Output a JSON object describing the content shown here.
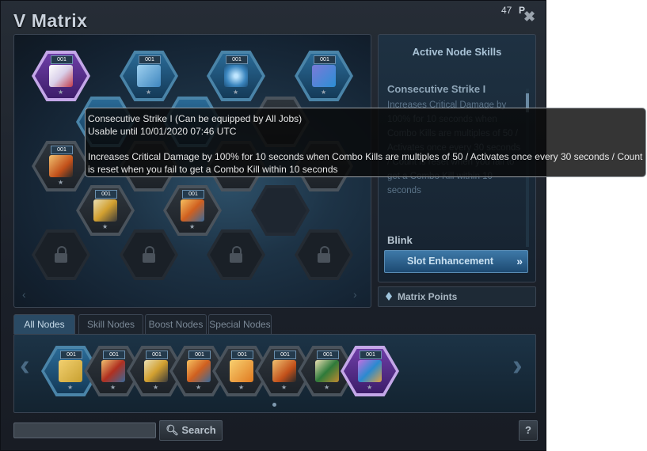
{
  "window": {
    "title": "V Matrix",
    "close_glyph": "✖"
  },
  "matrix": {
    "node_level": "001",
    "star": "★",
    "nav_left": "‹",
    "nav_right": "›",
    "nodes": [
      {
        "icon": "consecutive-strike-icon",
        "style": "purple"
      },
      {
        "icon": "skill-node-icon-2",
        "style": "blue"
      },
      {
        "icon": "skill-node-icon-3",
        "style": "blue"
      },
      {
        "icon": "skill-node-icon-4",
        "style": "blue"
      },
      {
        "icon": "boost-node-icon-1",
        "style": "boost"
      },
      {
        "icon": "boost-node-icon-2",
        "style": "boost"
      },
      {
        "icon": "boost-node-icon-3",
        "style": "boost"
      },
      {
        "icon": "locked-slot-icon",
        "style": "lock"
      }
    ]
  },
  "side_panel": {
    "header": "Active Node Skills",
    "skill_name": "Consecutive Strike I",
    "skill_desc": "Increases Critical Damage by 100% for 10 seconds when Combo Kills are multiples of 50 / Activates once every 30 seconds / Count is reset when you fail to get a Combo Kill within 10 seconds",
    "next_skill": "Blink",
    "slot_button": "Slot Enhancement",
    "slot_button_arrows": "»"
  },
  "matrix_points": {
    "label": "Matrix Points",
    "value": "47",
    "unit": "P"
  },
  "tabs": [
    {
      "label": "All Nodes",
      "active": true
    },
    {
      "label": "Skill Nodes",
      "active": false
    },
    {
      "label": "Boost Nodes",
      "active": false
    },
    {
      "label": "Special Nodes",
      "active": false
    }
  ],
  "inventory": {
    "nav_left": "‹",
    "nav_right": "›",
    "item_count": 8
  },
  "search": {
    "value": "",
    "button_label": "Search"
  },
  "help": {
    "label": "?"
  },
  "tooltip": {
    "line1": "Consecutive Strike I (Can be equipped by All Jobs)",
    "line2": "Usable until 10/01/2020 07:46 UTC",
    "line3": "Increases Critical Damage by 100% for 10 seconds when Combo Kills are multiples of 50 / Activates once every 30 seconds / Count is reset when you fail to get a Combo Kill within 10 seconds"
  },
  "colors": {
    "accent": "#3e79a8",
    "purple_node": "#6d3ea6",
    "panel_bg": "#1b2029"
  }
}
